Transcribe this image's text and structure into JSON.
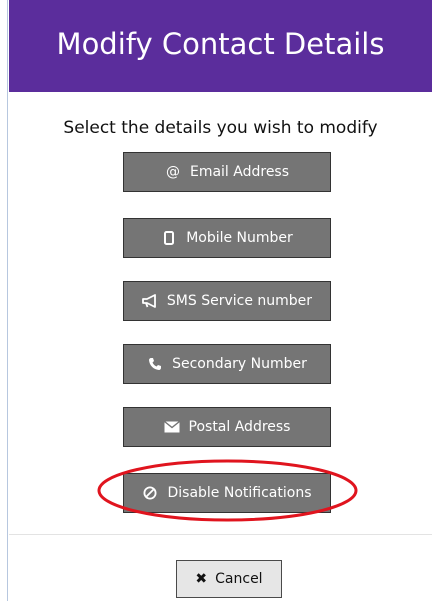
{
  "dialog": {
    "title": "Modify Contact Details",
    "prompt": "Select the details you wish to modify",
    "header_color": "#5b2d9c"
  },
  "options": [
    {
      "label": "Email Address",
      "icon": "at-icon",
      "glyph": "@"
    },
    {
      "label": "Mobile Number",
      "icon": "mobile-icon",
      "glyph": "▯"
    },
    {
      "label": "SMS Service number",
      "icon": "bullhorn-icon",
      "glyph": ""
    },
    {
      "label": "Secondary Number",
      "icon": "phone-icon",
      "glyph": "✆"
    },
    {
      "label": "Postal Address",
      "icon": "envelope-icon",
      "glyph": "✉"
    },
    {
      "label": "Disable Notifications",
      "icon": "ban-icon",
      "glyph": "⊘"
    }
  ],
  "highlight": {
    "target": "Disable Notifications",
    "color": "#e0141e"
  },
  "footer": {
    "cancel_label": "Cancel",
    "cancel_icon": "close-icon",
    "cancel_glyph": "✖"
  }
}
